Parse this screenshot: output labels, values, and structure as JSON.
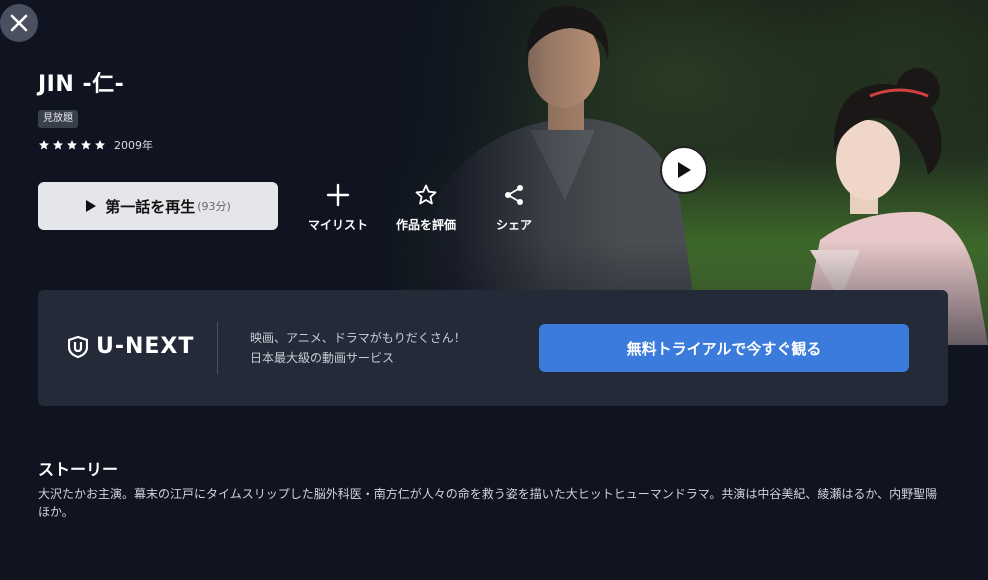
{
  "title": "JIN -仁-",
  "badge": "見放題",
  "rating": 5,
  "year": "2009年",
  "play": {
    "label": "第一話を再生",
    "duration": "(93分)"
  },
  "actions": [
    {
      "icon": "plus-icon",
      "label": "マイリスト"
    },
    {
      "icon": "star-outline-icon",
      "label": "作品を評価"
    },
    {
      "icon": "share-icon",
      "label": "シェア"
    }
  ],
  "promo": {
    "logo": "U-NEXT",
    "line1": "映画、アニメ、ドラマがもりだくさん！",
    "line2": "日本最大級の動画サービス",
    "cta": "無料トライアルで今すぐ観る"
  },
  "story": {
    "heading": "ストーリー",
    "text": "大沢たかお主演。幕末の江戸にタイムスリップした脳外科医・南方仁が人々の命を救う姿を描いた大ヒットヒューマンドラマ。共演は中谷美紀、綾瀬はるか、内野聖陽ほか。"
  },
  "colors": {
    "background": "#0f1420",
    "cta": "#3b7bdc",
    "promo_panel": "#242a38"
  }
}
